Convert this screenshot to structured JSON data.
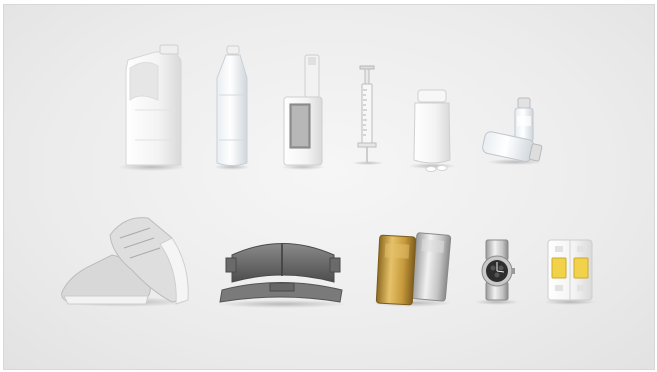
{
  "scene": {
    "description_free": true,
    "objects": [
      {
        "name": "jerry-can"
      },
      {
        "name": "water-bottle"
      },
      {
        "name": "inhaler-device"
      },
      {
        "name": "syringe"
      },
      {
        "name": "pill-bottle"
      },
      {
        "name": "vials"
      },
      {
        "name": "sneakers"
      },
      {
        "name": "brake-pad"
      },
      {
        "name": "gold-bars"
      },
      {
        "name": "wristwatch"
      },
      {
        "name": "circuit-breaker"
      }
    ]
  },
  "colors": {
    "background": "#ececec",
    "plastic_white": "#f4f4f4",
    "gold": "#c9a24a",
    "silver": "#c8c8c8",
    "dark_metal": "#6a6a6a",
    "breaker_yellow": "#f2d24b"
  }
}
